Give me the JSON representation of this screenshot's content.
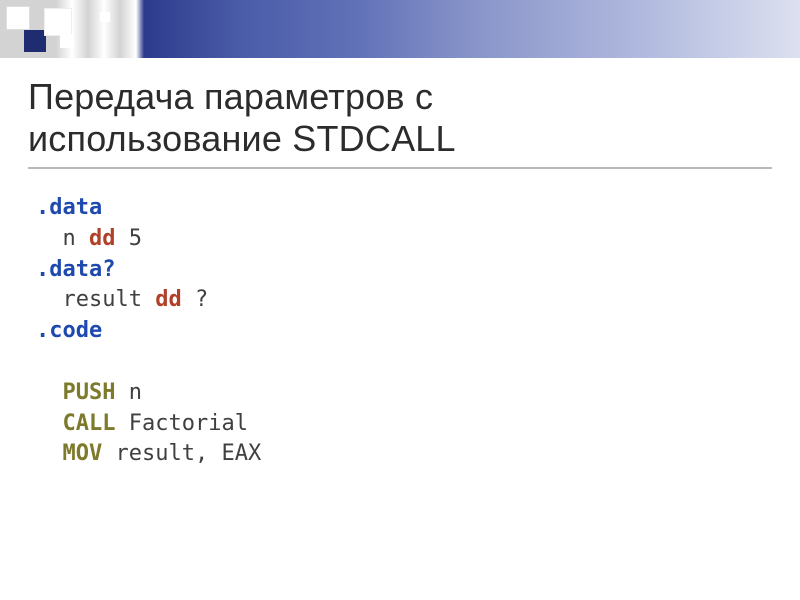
{
  "slide": {
    "title_line1": "Передача параметров с",
    "title_line2": "использование STDCALL"
  },
  "code": {
    "lines": [
      {
        "indent": "",
        "tokens": [
          {
            "cls": "k-blue",
            "text": ".data"
          }
        ]
      },
      {
        "indent": "  ",
        "tokens": [
          {
            "cls": "plain",
            "text": "n "
          },
          {
            "cls": "k-red",
            "text": "dd"
          },
          {
            "cls": "plain",
            "text": " 5"
          }
        ]
      },
      {
        "indent": "",
        "tokens": [
          {
            "cls": "k-blue",
            "text": ".data?"
          }
        ]
      },
      {
        "indent": "  ",
        "tokens": [
          {
            "cls": "plain",
            "text": "result "
          },
          {
            "cls": "k-red",
            "text": "dd"
          },
          {
            "cls": "plain",
            "text": " ?"
          }
        ]
      },
      {
        "indent": "",
        "tokens": [
          {
            "cls": "k-blue",
            "text": ".code"
          }
        ]
      },
      {
        "indent": "",
        "tokens": [
          {
            "cls": "plain",
            "text": " "
          }
        ]
      },
      {
        "indent": "  ",
        "tokens": [
          {
            "cls": "k-olive",
            "text": "PUSH"
          },
          {
            "cls": "plain",
            "text": " n"
          }
        ]
      },
      {
        "indent": "  ",
        "tokens": [
          {
            "cls": "k-olive",
            "text": "CALL"
          },
          {
            "cls": "plain",
            "text": " Factorial"
          }
        ]
      },
      {
        "indent": "  ",
        "tokens": [
          {
            "cls": "k-olive",
            "text": "MOV"
          },
          {
            "cls": "plain",
            "text": " result, EAX"
          }
        ]
      }
    ]
  }
}
